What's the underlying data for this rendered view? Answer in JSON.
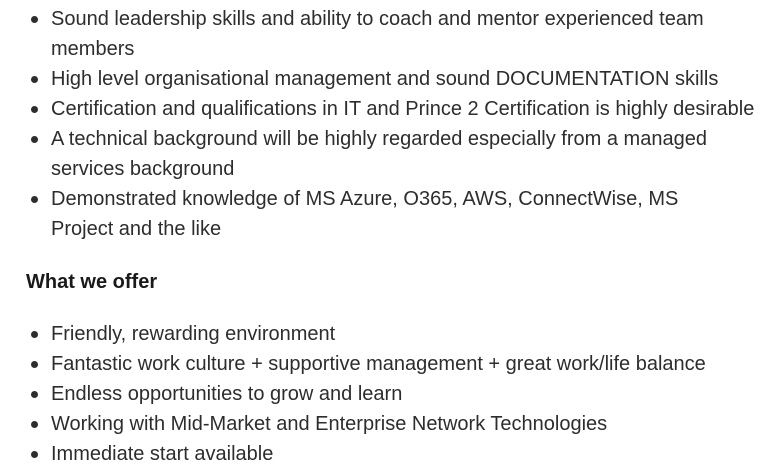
{
  "requirements": {
    "items": [
      "Sound leadership skills and ability to coach and mentor experienced team members",
      "High level organisational management and sound DOCUMENTATION skills",
      "Certification and qualifications in IT and Prince 2 Certification is highly desirable",
      "A technical background will be highly regarded especially from a managed services background",
      "Demonstrated knowledge of MS Azure, O365, AWS, ConnectWise, MS Project and the like"
    ]
  },
  "offer": {
    "heading": "What we offer",
    "items": [
      "Friendly, rewarding environment",
      "Fantastic work culture + supportive management + great work/life balance",
      "Endless opportunities to grow and learn",
      "Working with Mid-Market and Enterprise Network Technologies",
      "Immediate start available"
    ]
  }
}
